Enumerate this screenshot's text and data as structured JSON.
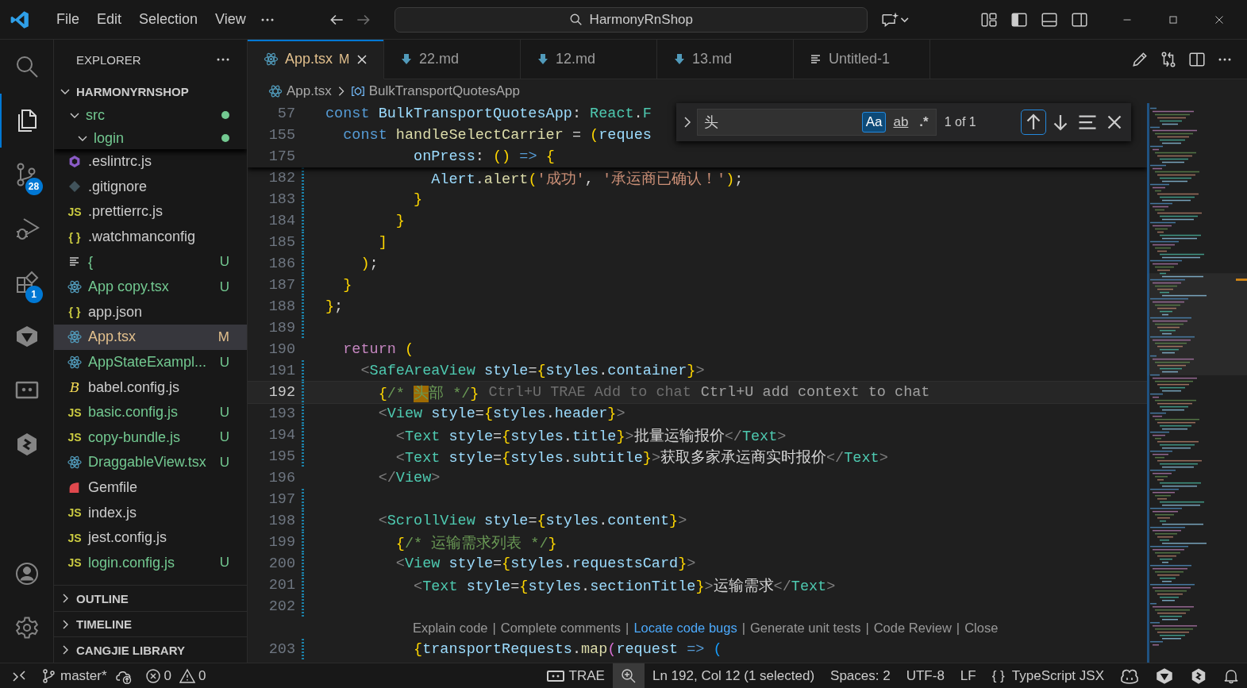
{
  "title_bar": {
    "menu": [
      "File",
      "Edit",
      "Selection",
      "View"
    ],
    "search": "HarmonyRnShop"
  },
  "activity_bar": [
    {
      "kind": "search",
      "selected": false
    },
    {
      "kind": "explorer",
      "selected": true
    },
    {
      "kind": "source-control",
      "selected": false,
      "badge": "28"
    },
    {
      "kind": "run-debug",
      "selected": false
    },
    {
      "kind": "extensions",
      "selected": false,
      "badge": "1"
    },
    {
      "kind": "trae",
      "selected": false
    },
    {
      "kind": "remote",
      "selected": false
    },
    {
      "kind": "hexagon",
      "selected": false
    }
  ],
  "activity_bottom": [
    {
      "kind": "account"
    },
    {
      "kind": "settings"
    }
  ],
  "sidebar": {
    "title": "EXPLORER",
    "root": {
      "label": "HARMONYRNSHOP",
      "expanded": true,
      "children": [
        {
          "label": "src",
          "expanded": true,
          "color": "#73c991",
          "children": [
            {
              "label": "login",
              "expanded": true,
              "color": "#73c991"
            }
          ]
        }
      ]
    },
    "files": [
      {
        "name": ".eslintrc.js",
        "kind": "eslint",
        "color": "#cccccc",
        "selected": false
      },
      {
        "name": ".gitignore",
        "kind": "git",
        "color": "#cccccc",
        "selected": false
      },
      {
        "name": ".prettierrc.js",
        "kind": "label",
        "icon_label": "JS",
        "color": "#cccccc",
        "selected": false
      },
      {
        "name": ".watchmanconfig",
        "kind": "label",
        "icon_label": "{ }",
        "color": "#cccccc",
        "selected": false
      },
      {
        "name": "{",
        "kind": "lines",
        "color": "#73c991",
        "badge": "U",
        "selected": false
      },
      {
        "name": "App copy.tsx",
        "kind": "react",
        "color": "#73c991",
        "badge": "U",
        "selected": false
      },
      {
        "name": "app.json",
        "kind": "label",
        "icon_label": "{ }",
        "color": "#cccccc",
        "selected": false
      },
      {
        "name": "App.tsx",
        "kind": "react",
        "color": "#e2c08d",
        "badge": "M",
        "selected": true
      },
      {
        "name": "AppStateExampl...",
        "kind": "react",
        "color": "#73c991",
        "badge": "U",
        "selected": false
      },
      {
        "name": "babel.config.js",
        "kind": "babel",
        "icon_label": "B",
        "color": "#cccccc",
        "selected": false
      },
      {
        "name": "basic.config.js",
        "kind": "label",
        "icon_label": "JS",
        "color": "#73c991",
        "badge": "U",
        "selected": false
      },
      {
        "name": "copy-bundle.js",
        "kind": "label",
        "icon_label": "JS",
        "color": "#73c991",
        "badge": "U",
        "selected": false
      },
      {
        "name": "DraggableView.tsx",
        "kind": "react",
        "color": "#73c991",
        "badge": "U",
        "selected": false
      },
      {
        "name": "Gemfile",
        "kind": "gem",
        "color": "#cccccc",
        "selected": false
      },
      {
        "name": "index.js",
        "kind": "label",
        "icon_label": "JS",
        "color": "#cccccc",
        "selected": false
      },
      {
        "name": "jest.config.js",
        "kind": "label",
        "icon_label": "JS",
        "color": "#cccccc",
        "selected": false
      },
      {
        "name": "login.config.js",
        "kind": "label",
        "icon_label": "JS",
        "color": "#73c991",
        "badge": "U",
        "selected": false
      }
    ],
    "sections": [
      {
        "label": "OUTLINE",
        "expanded": false
      },
      {
        "label": "TIMELINE",
        "expanded": false
      },
      {
        "label": "CANGJIE LIBRARY",
        "expanded": false
      }
    ]
  },
  "tabs": [
    {
      "label": "App.tsx",
      "kind": "react",
      "selected": true,
      "color": "#e2c08d",
      "badge": "M"
    },
    {
      "label": "22.md",
      "kind": "download",
      "selected": false,
      "color": "#9d9d9d"
    },
    {
      "label": "12.md",
      "kind": "download",
      "selected": false,
      "color": "#9d9d9d"
    },
    {
      "label": "13.md",
      "kind": "download",
      "selected": false,
      "color": "#9d9d9d"
    },
    {
      "label": "Untitled-1",
      "kind": "lines",
      "selected": false,
      "color": "#9d9d9d"
    }
  ],
  "breadcrumbs": [
    {
      "label": "App.tsx",
      "kind": "react"
    },
    {
      "label": "BulkTransportQuotesApp",
      "kind": "symbol"
    }
  ],
  "find": {
    "query": "头",
    "options": [
      {
        "kind": "case",
        "label": "Aa",
        "selected": true
      },
      {
        "kind": "word",
        "label": "ab",
        "selected": false
      },
      {
        "kind": "regex",
        "label": ".*",
        "selected": false
      }
    ],
    "result": "1 of 1"
  },
  "sticky_lines": [
    {
      "number": "57",
      "text": "const BulkTransportQuotesApp: React.F"
    },
    {
      "number": "155",
      "text": "  const handleSelectCarrier = (reques"
    },
    {
      "number": "175",
      "text": "          onPress: () => {"
    }
  ],
  "lines": [
    {
      "kind": "code",
      "number": "182",
      "modified": true,
      "current": false,
      "text": "            Alert.alert('成功', '承运商已确认！');"
    },
    {
      "kind": "code",
      "number": "183",
      "modified": true,
      "current": false,
      "text": "          }"
    },
    {
      "kind": "code",
      "number": "184",
      "modified": true,
      "current": false,
      "text": "        }"
    },
    {
      "kind": "code",
      "number": "185",
      "modified": true,
      "current": false,
      "text": "      ]"
    },
    {
      "kind": "code",
      "number": "186",
      "modified": true,
      "current": false,
      "text": "    );"
    },
    {
      "kind": "code",
      "number": "187",
      "modified": true,
      "current": false,
      "text": "  }"
    },
    {
      "kind": "code",
      "number": "188",
      "modified": true,
      "current": false,
      "text": "};"
    },
    {
      "kind": "code",
      "number": "189",
      "modified": true,
      "current": false
    },
    {
      "kind": "code",
      "number": "190",
      "modified": false,
      "current": false,
      "text": "  return ("
    },
    {
      "kind": "code",
      "number": "191",
      "modified": true,
      "current": false,
      "text": "    <SafeAreaView style={styles.container}>"
    },
    {
      "kind": "code",
      "number": "192",
      "modified": true,
      "current": true,
      "text": "      {/* 头部 */}",
      "ghost": [
        {
          "text": "Ctrl+U TRAE Add to chat",
          "strong": false
        },
        {
          "text": "Ctrl+U add context to chat",
          "strong": true
        }
      ]
    },
    {
      "kind": "code",
      "number": "193",
      "modified": true,
      "current": false,
      "text": "      <View style={styles.header}>"
    },
    {
      "kind": "code",
      "number": "194",
      "modified": true,
      "current": false,
      "text": "        <Text style={styles.title}>批量运输报价</Text>"
    },
    {
      "kind": "code",
      "number": "195",
      "modified": true,
      "current": false,
      "text": "        <Text style={styles.subtitle}>获取多家承运商实时报价</Text>"
    },
    {
      "kind": "code",
      "number": "196",
      "modified": false,
      "current": false,
      "text": "      </View>"
    },
    {
      "kind": "code",
      "number": "197",
      "modified": true,
      "current": false
    },
    {
      "kind": "code",
      "number": "198",
      "modified": true,
      "current": false,
      "text": "      <ScrollView style={styles.content}>"
    },
    {
      "kind": "code",
      "number": "199",
      "modified": true,
      "current": false,
      "text": "        {/* 运输需求列表 */}"
    },
    {
      "kind": "code",
      "number": "200",
      "modified": true,
      "current": false,
      "text": "        <View style={styles.requestsCard}>"
    },
    {
      "kind": "code",
      "number": "201",
      "modified": true,
      "current": false,
      "text": "          <Text style={styles.sectionTitle}>运输需求</Text>"
    },
    {
      "kind": "code",
      "number": "202",
      "modified": true,
      "current": false
    },
    {
      "kind": "codelens",
      "items": [
        {
          "text": "Explain code",
          "link": false
        },
        {
          "text": "|",
          "link": false
        },
        {
          "text": "Complete comments",
          "link": false
        },
        {
          "text": "|",
          "link": false
        },
        {
          "text": "Locate code bugs",
          "link": true
        },
        {
          "text": "|",
          "link": false
        },
        {
          "text": "Generate unit tests",
          "link": false
        },
        {
          "text": "|",
          "link": false
        },
        {
          "text": "Code Review",
          "link": false
        },
        {
          "text": "|",
          "link": false
        },
        {
          "text": "Close",
          "link": false
        }
      ]
    },
    {
      "kind": "code",
      "number": "203",
      "modified": true,
      "current": false,
      "text": "          {transportRequests.map(request => ("
    }
  ],
  "status_bar": {
    "left": [
      {
        "kind": "remote"
      },
      {
        "kind": "branch",
        "label": "master*"
      },
      {
        "kind": "sync"
      },
      {
        "kind": "problems",
        "errors": "0",
        "warnings": "0"
      }
    ],
    "right": [
      {
        "kind": "trae",
        "label": "TRAE",
        "highlighted": false
      },
      {
        "kind": "zoom",
        "highlighted": true
      },
      {
        "kind": "text",
        "label": "Ln 192, Col 12 (1 selected)",
        "highlighted": false
      },
      {
        "kind": "text",
        "label": "Spaces: 2",
        "highlighted": false
      },
      {
        "kind": "text",
        "label": "UTF-8",
        "highlighted": false
      },
      {
        "kind": "text",
        "label": "LF",
        "highlighted": false
      },
      {
        "kind": "lang",
        "icon_label": "{ }",
        "label": "TypeScript JSX",
        "highlighted": false
      },
      {
        "kind": "copilot",
        "highlighted": false
      },
      {
        "kind": "trae-logo",
        "highlighted": false
      },
      {
        "kind": "hexagon",
        "highlighted": false
      },
      {
        "kind": "bell",
        "highlighted": false
      }
    ]
  }
}
